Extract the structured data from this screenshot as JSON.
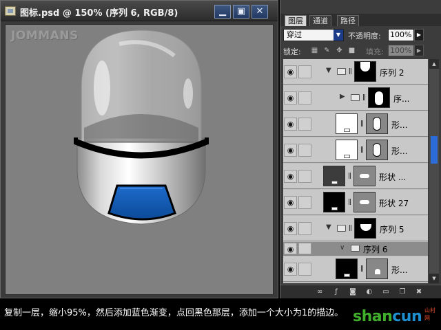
{
  "document": {
    "title": "图标.psd @ 150% (序列 6, RGB/8)",
    "watermark": "JOMMANS",
    "window_buttons": {
      "minimize": "▁",
      "maximize": "▣",
      "close": "✕"
    }
  },
  "layers_panel": {
    "tabs": [
      "图层",
      "通道",
      "路径"
    ],
    "active_tab": "图层",
    "blend_mode": "穿过",
    "opacity_label": "不透明度:",
    "opacity_value": "100%",
    "lock_label": "锁定:",
    "fill_label": "填充:",
    "fill_value": "100%",
    "layers": [
      {
        "name": "序列 2",
        "type": "group",
        "expanded": true,
        "visible": true
      },
      {
        "name": "序...",
        "type": "group",
        "expanded": false,
        "visible": true
      },
      {
        "name": "形...",
        "type": "shape",
        "visible": true
      },
      {
        "name": "形...",
        "type": "shape",
        "visible": true
      },
      {
        "name": "形状 ...",
        "type": "shape",
        "visible": true
      },
      {
        "name": "形状 27",
        "type": "shape",
        "visible": true
      },
      {
        "name": "序列 5",
        "type": "group",
        "expanded": true,
        "visible": true
      },
      {
        "name": "序列 6",
        "type": "group",
        "expanded": true,
        "visible": true,
        "selected": true
      },
      {
        "name": "形...",
        "type": "shape",
        "visible": true
      }
    ]
  },
  "caption": "复制一层，缩小95%，然后添加蓝色渐变，点回黑色那层，添加一个大小为1的描边。",
  "site_logo": {
    "main": "shan",
    "accent": "cun",
    "suffix": ".net",
    "small": "山村网"
  },
  "colors": {
    "accent_blue": "#1a5fb4",
    "canvas_grey": "#808080",
    "panel_bg": "#3c3c3c"
  }
}
